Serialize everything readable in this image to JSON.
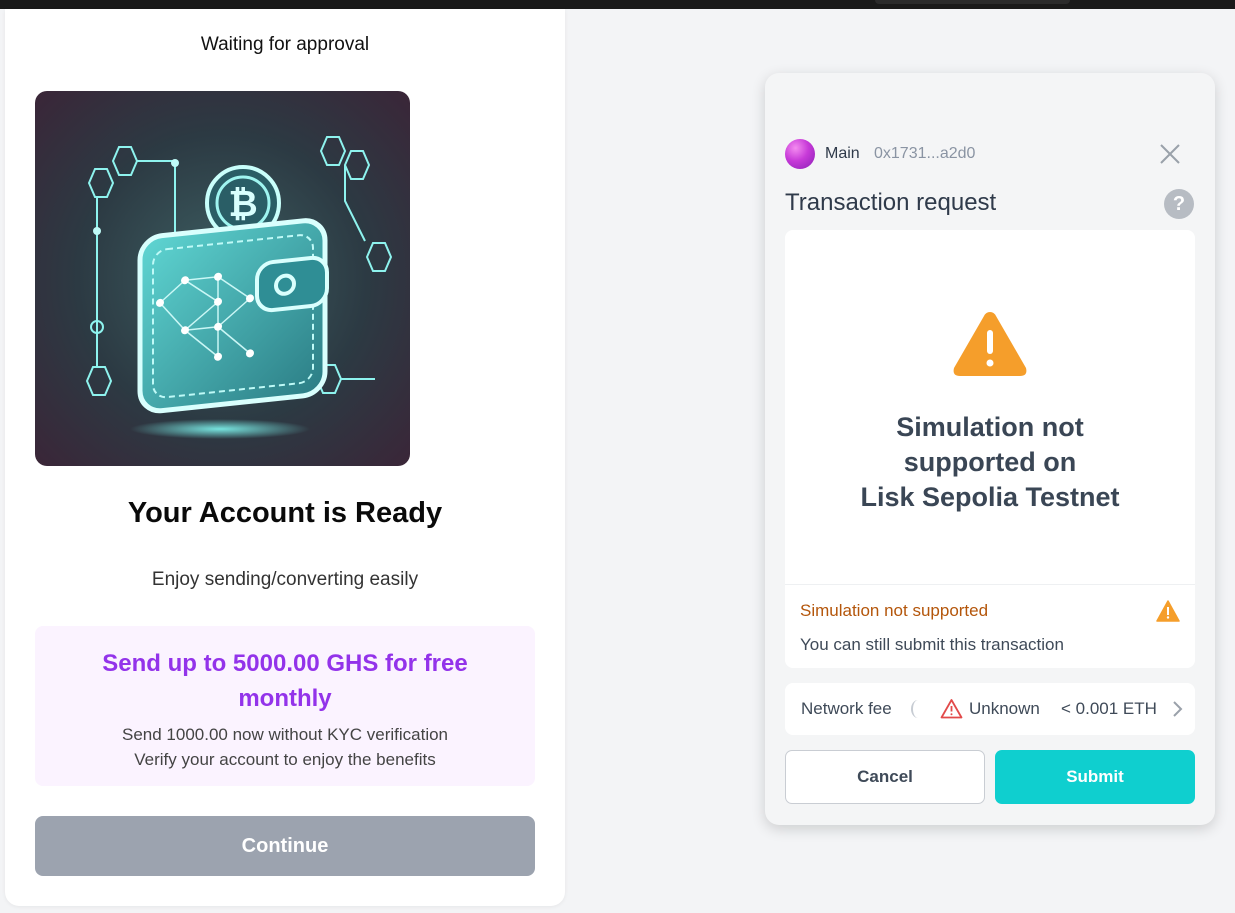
{
  "onboarding": {
    "status_text": "Waiting for approval",
    "image_icon": "crypto-wallet-illustration",
    "title": "Your Account is Ready",
    "subtitle": "Enjoy sending/converting easily",
    "promo": {
      "title": "Send up to 5000.00 GHS for free monthly",
      "line1": "Send 1000.00 now without KYC verification",
      "line2": "Verify your account to enjoy the benefits",
      "accent_color": "#9333ea"
    },
    "continue_label": "Continue"
  },
  "wallet_popup": {
    "account_name": "Main",
    "account_address": "0x1731...a2d0",
    "title": "Transaction request",
    "help_label": "?",
    "simulation": {
      "heading_line1": "Simulation not",
      "heading_line2": "supported on",
      "heading_line3": "Lisk Sepolia Testnet",
      "notice": "Simulation not supported",
      "detail": "You can still submit this transaction",
      "warning_color": "#f59e2b"
    },
    "network_fee": {
      "label": "Network fee",
      "status": "Unknown",
      "amount": "< 0.001 ETH"
    },
    "cancel_label": "Cancel",
    "submit_label": "Submit",
    "submit_color": "#0fcfcf"
  }
}
